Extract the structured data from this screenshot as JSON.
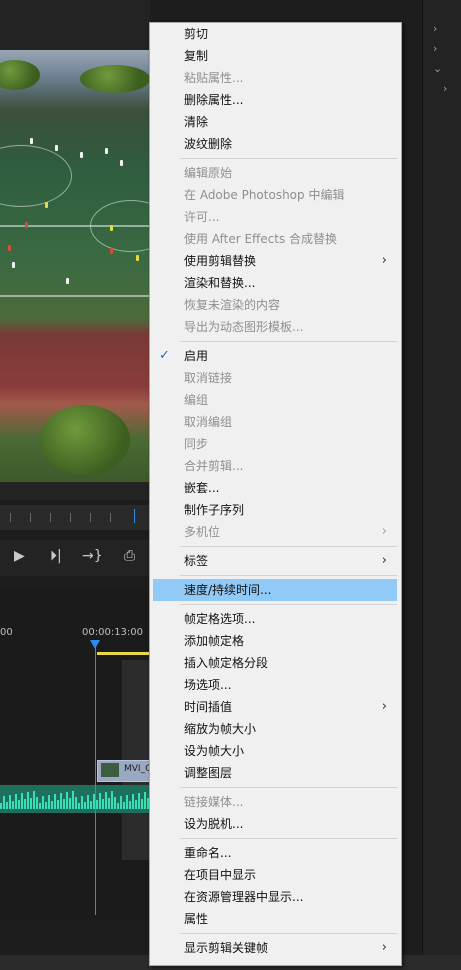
{
  "timeline": {
    "timecode_start": "00",
    "timecode": "00:00:13:00",
    "clip_label": "MVI_C"
  },
  "menu": {
    "groups": [
      [
        {
          "label": "剪切",
          "enabled": true
        },
        {
          "label": "复制",
          "enabled": true
        },
        {
          "label": "粘贴属性...",
          "enabled": false
        },
        {
          "label": "删除属性...",
          "enabled": true
        },
        {
          "label": "清除",
          "enabled": true
        },
        {
          "label": "波纹删除",
          "enabled": true
        }
      ],
      [
        {
          "label": "编辑原始",
          "enabled": false
        },
        {
          "label": "在 Adobe Photoshop 中编辑",
          "enabled": false
        },
        {
          "label": "许可...",
          "enabled": false
        },
        {
          "label": "使用 After Effects 合成替换",
          "enabled": false
        },
        {
          "label": "使用剪辑替换",
          "enabled": true,
          "submenu": true
        },
        {
          "label": "渲染和替换...",
          "enabled": true
        },
        {
          "label": "恢复未渲染的内容",
          "enabled": false
        },
        {
          "label": "导出为动态图形模板...",
          "enabled": false
        }
      ],
      [
        {
          "label": "启用",
          "enabled": true,
          "checked": true
        },
        {
          "label": "取消链接",
          "enabled": false
        },
        {
          "label": "编组",
          "enabled": false
        },
        {
          "label": "取消编组",
          "enabled": false
        },
        {
          "label": "同步",
          "enabled": false
        },
        {
          "label": "合并剪辑...",
          "enabled": false
        },
        {
          "label": "嵌套...",
          "enabled": true
        },
        {
          "label": "制作子序列",
          "enabled": true
        },
        {
          "label": "多机位",
          "enabled": false,
          "submenu": true
        }
      ],
      [
        {
          "label": "标签",
          "enabled": true,
          "submenu": true
        }
      ],
      [
        {
          "label": "速度/持续时间...",
          "enabled": true,
          "highlighted": true
        }
      ],
      [
        {
          "label": "帧定格选项...",
          "enabled": true
        },
        {
          "label": "添加帧定格",
          "enabled": true
        },
        {
          "label": "插入帧定格分段",
          "enabled": true
        },
        {
          "label": "场选项...",
          "enabled": true
        },
        {
          "label": "时间插值",
          "enabled": true,
          "submenu": true
        },
        {
          "label": "缩放为帧大小",
          "enabled": true
        },
        {
          "label": "设为帧大小",
          "enabled": true
        },
        {
          "label": "调整图层",
          "enabled": true
        }
      ],
      [
        {
          "label": "链接媒体...",
          "enabled": false
        },
        {
          "label": "设为脱机...",
          "enabled": true
        }
      ],
      [
        {
          "label": "重命名...",
          "enabled": true
        },
        {
          "label": "在项目中显示",
          "enabled": true
        },
        {
          "label": "在资源管理器中显示...",
          "enabled": true
        },
        {
          "label": "属性",
          "enabled": true
        }
      ],
      [
        {
          "label": "显示剪辑关键帧",
          "enabled": true,
          "submenu": true
        }
      ]
    ]
  }
}
